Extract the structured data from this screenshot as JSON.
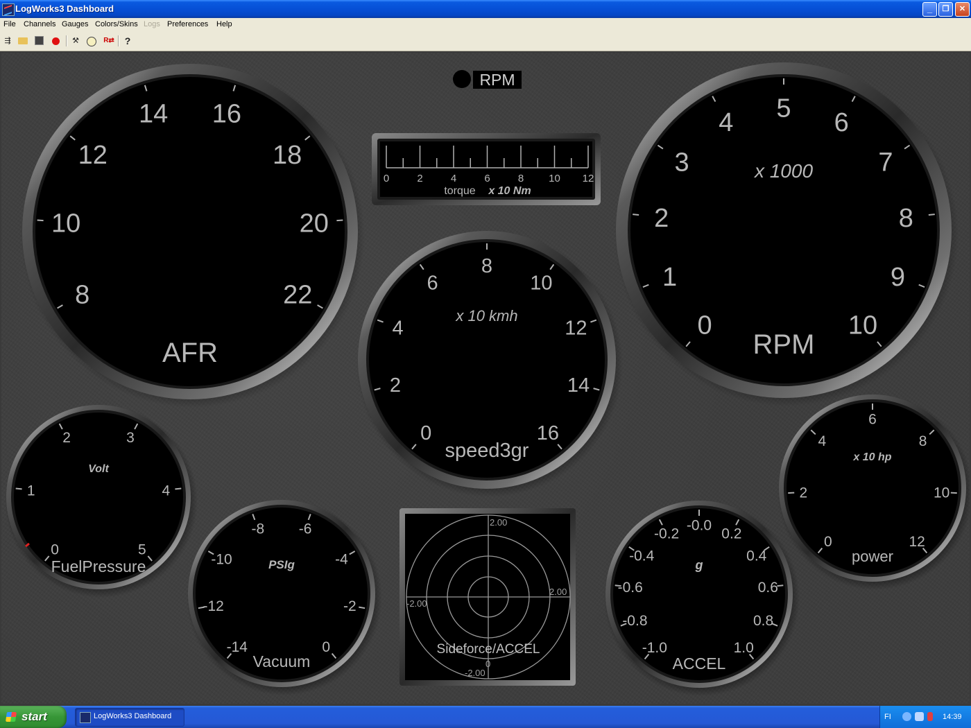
{
  "window": {
    "title": "LogWorks3 Dashboard",
    "minimize": "_",
    "maximize": "❐",
    "close": "✕"
  },
  "menu": [
    {
      "label": "File",
      "enabled": true
    },
    {
      "label": "Channels",
      "enabled": true
    },
    {
      "label": "Gauges",
      "enabled": true
    },
    {
      "label": "Colors/Skins",
      "enabled": true
    },
    {
      "label": "Logs",
      "enabled": false
    },
    {
      "label": "Preferences",
      "enabled": true
    },
    {
      "label": "Help",
      "enabled": true
    }
  ],
  "toolbar": [
    "new-dashboard-icon",
    "open-icon",
    "save-icon",
    "record-icon",
    "tools-icon",
    "gauge-setup-icon",
    "rate-icon",
    "help-icon"
  ],
  "toolbar_help_glyph": "?",
  "dashboard": {
    "indicator_label": "RPM",
    "afr": {
      "ticks": [
        "8",
        "10",
        "12",
        "14",
        "16",
        "18",
        "20",
        "22"
      ],
      "label": "AFR",
      "unit": ""
    },
    "rpm": {
      "ticks": [
        "0",
        "1",
        "2",
        "3",
        "4",
        "5",
        "6",
        "7",
        "8",
        "9",
        "10"
      ],
      "label": "RPM",
      "unit": "x 1000"
    },
    "speed": {
      "ticks": [
        "0",
        "2",
        "4",
        "6",
        "8",
        "10",
        "12",
        "14",
        "16"
      ],
      "label": "speed3gr",
      "unit": "x 10 kmh"
    },
    "torque": {
      "ticks": [
        "0",
        "2",
        "4",
        "6",
        "8",
        "10",
        "12"
      ],
      "label": "torque",
      "unit": "x 10 Nm"
    },
    "fuelpressure": {
      "ticks": [
        "0",
        "1",
        "2",
        "3",
        "4",
        "5"
      ],
      "label": "FuelPressure",
      "unit": "Volt"
    },
    "vacuum": {
      "ticks": [
        "-14",
        "-12",
        "-10",
        "-8",
        "-6",
        "-4",
        "-2",
        "0"
      ],
      "label": "Vacuum",
      "unit": "PSIg"
    },
    "accel": {
      "ticks": [
        "-1.0",
        "-0.8",
        "-0.6",
        "-0.4",
        "-0.2",
        "-0.0",
        "0.2",
        "0.4",
        "0.6",
        "0.8",
        "1.0"
      ],
      "label": "ACCEL",
      "unit": "g"
    },
    "power": {
      "ticks": [
        "0",
        "2",
        "4",
        "6",
        "8",
        "10",
        "12"
      ],
      "label": "power",
      "unit": "x 10 hp"
    },
    "sideforce": {
      "label": "Sideforce/ACCEL",
      "top": "2.00",
      "right": "2.00",
      "left": "-2.00",
      "bottom": "-2.00",
      "center": "0"
    }
  },
  "taskbar": {
    "start_label": "start",
    "task_label": "LogWorks3 Dashboard",
    "language": "FI",
    "clock": "14:39"
  },
  "colors": {
    "title_blue": "#0650d6",
    "gauge_face": "#000000",
    "gauge_text": "#b8b8b8",
    "taskbar_blue": "#245edb",
    "start_green": "#379637"
  }
}
